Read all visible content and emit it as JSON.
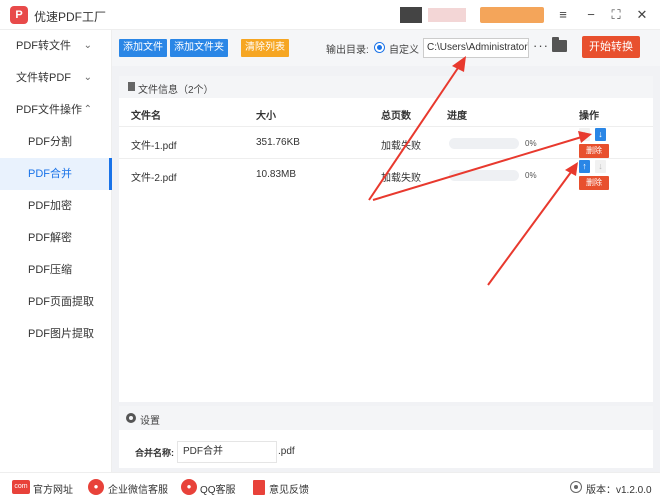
{
  "app": {
    "title": "优速PDF工厂",
    "logo_text": "P"
  },
  "window_controls": {
    "menu": "≡",
    "minimize": "−",
    "maximize": "⛶",
    "close": "✕"
  },
  "sidebar": {
    "items": [
      {
        "label": "PDF转文件",
        "chevron": "⌄"
      },
      {
        "label": "文件转PDF",
        "chevron": "⌄"
      },
      {
        "label": "PDF文件操作",
        "chevron": "⌃"
      },
      {
        "label": "PDF分割"
      },
      {
        "label": "PDF合并"
      },
      {
        "label": "PDF加密"
      },
      {
        "label": "PDF解密"
      },
      {
        "label": "PDF压缩"
      },
      {
        "label": "PDF页面提取"
      },
      {
        "label": "PDF图片提取"
      }
    ]
  },
  "toolbar": {
    "add_file": "添加文件",
    "add_folder": "添加文件夹",
    "clear_list": "清除列表",
    "output_label": "输出目录:",
    "custom_label": "自定义",
    "output_path": "C:\\Users\\Administrator\\",
    "more": "···",
    "start": "开始转换"
  },
  "file_panel": {
    "title": "文件信息（2个）",
    "columns": [
      "文件名",
      "大小",
      "总页数",
      "进度",
      "操作"
    ],
    "rows": [
      {
        "name": "文件-1.pdf",
        "size": "351.76KB",
        "pages": "加载失败",
        "progress": 0,
        "progress_text": "0%",
        "up_enabled": false,
        "down_enabled": true
      },
      {
        "name": "文件-2.pdf",
        "size": "10.83MB",
        "pages": "加载失败",
        "progress": 0,
        "progress_text": "0%",
        "up_enabled": true,
        "down_enabled": false
      }
    ],
    "up_glyph": "↑",
    "down_glyph": "↓",
    "delete_label": "删除"
  },
  "settings": {
    "title": "设置",
    "merge_name_label": "合并名称:",
    "merge_name_value": "PDF合并",
    "merge_ext": ".pdf"
  },
  "footer": {
    "website": "官方网址",
    "wechat": "企业微信客服",
    "qq": "QQ客服",
    "feedback": "意见反馈",
    "version": "版本：v1.2.0.0"
  },
  "colors": {
    "accent": "#2a86e6",
    "start_button": "#e8502e",
    "clear_button": "#f6a623",
    "annotation_arrow": "#e8392e"
  }
}
